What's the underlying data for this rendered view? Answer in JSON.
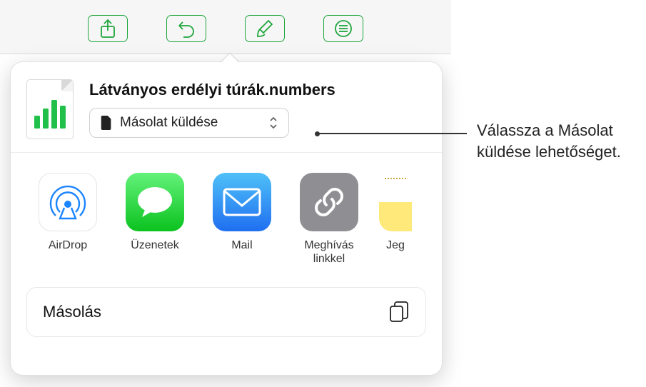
{
  "toolbar": {
    "share": "share-icon",
    "undo": "undo-icon",
    "format": "paintbrush-icon",
    "more": "more-menu-icon"
  },
  "sheet": {
    "document_title": "Látványos erdélyi túrák.numbers",
    "send_select_label": "Másolat küldése",
    "share_targets": [
      {
        "id": "airdrop",
        "label": "AirDrop"
      },
      {
        "id": "messages",
        "label": "Üzenetek"
      },
      {
        "id": "mail",
        "label": "Mail"
      },
      {
        "id": "link",
        "label": "Meghívás linkkel"
      },
      {
        "id": "notes",
        "label": "Jegyzetek"
      }
    ],
    "copy_action_label": "Másolás"
  },
  "callout": {
    "text": "Válassza a Másolat küldése lehetőséget."
  },
  "colors": {
    "accent": "#1ea53b"
  }
}
